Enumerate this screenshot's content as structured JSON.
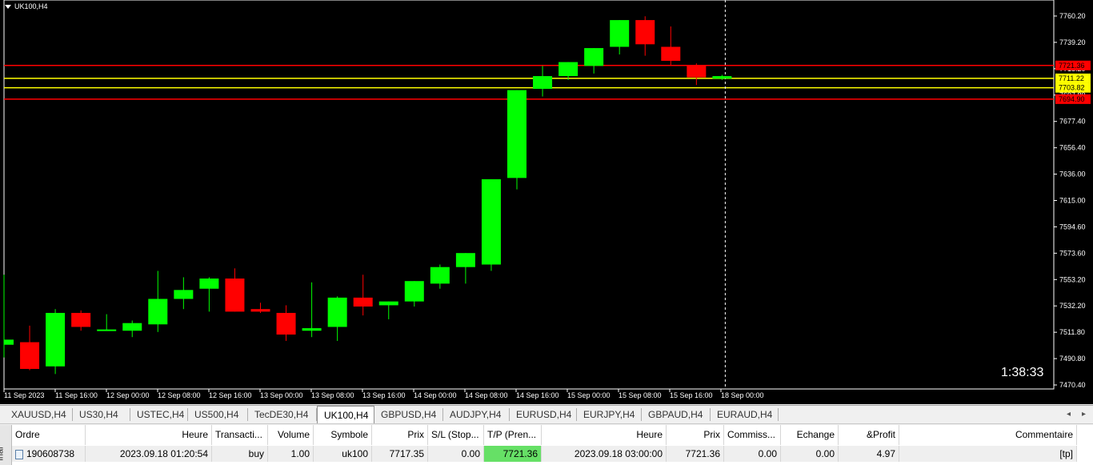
{
  "chart": {
    "symbol_label": "UK100,H4",
    "countdown": "1:38:33",
    "colors": {
      "background": "#000000",
      "bull": "#00ff00",
      "bear": "#ff0000",
      "wick_bull": "#00ff00",
      "wick_bear": "#ff0000",
      "red_line": "#ff0000",
      "yellow_line": "#ffff00",
      "axis_text": "#ffffff"
    }
  },
  "chart_data": {
    "type": "candlestick",
    "y_ticks": [
      "7760.20",
      "7739.20",
      "7718.20",
      "7697.80",
      "7677.40",
      "7656.40",
      "7636.00",
      "7615.00",
      "7594.60",
      "7573.60",
      "7553.20",
      "7532.20",
      "7511.80",
      "7490.80",
      "7470.40"
    ],
    "x_ticks": [
      "11 Sep 2023",
      "11 Sep 16:00",
      "12 Sep 00:00",
      "12 Sep 08:00",
      "12 Sep 16:00",
      "13 Sep 00:00",
      "13 Sep 08:00",
      "13 Sep 16:00",
      "14 Sep 00:00",
      "14 Sep 08:00",
      "14 Sep 16:00",
      "15 Sep 00:00",
      "15 Sep 08:00",
      "15 Sep 16:00",
      "18 Sep 00:00"
    ],
    "ylim": [
      7470.4,
      7760.2
    ],
    "candles": [
      {
        "o": 7502,
        "h": 7557,
        "l": 7492,
        "c": 7506
      },
      {
        "o": 7504,
        "h": 7517,
        "l": 7482,
        "c": 7483
      },
      {
        "o": 7485,
        "h": 7530,
        "l": 7479,
        "c": 7527
      },
      {
        "o": 7527,
        "h": 7529,
        "l": 7513,
        "c": 7516
      },
      {
        "o": 7513,
        "h": 7526,
        "l": 7513,
        "c": 7514
      },
      {
        "o": 7513,
        "h": 7521,
        "l": 7508,
        "c": 7519
      },
      {
        "o": 7518,
        "h": 7560,
        "l": 7512,
        "c": 7538
      },
      {
        "o": 7538,
        "h": 7555,
        "l": 7530,
        "c": 7545
      },
      {
        "o": 7546,
        "h": 7555,
        "l": 7528,
        "c": 7554
      },
      {
        "o": 7554,
        "h": 7562,
        "l": 7528,
        "c": 7528
      },
      {
        "o": 7530,
        "h": 7535,
        "l": 7527,
        "c": 7528
      },
      {
        "o": 7527,
        "h": 7533,
        "l": 7505,
        "c": 7510
      },
      {
        "o": 7513,
        "h": 7551,
        "l": 7508,
        "c": 7515
      },
      {
        "o": 7516,
        "h": 7540,
        "l": 7505,
        "c": 7539
      },
      {
        "o": 7539,
        "h": 7557,
        "l": 7525,
        "c": 7532
      },
      {
        "o": 7533,
        "h": 7536,
        "l": 7522,
        "c": 7536
      },
      {
        "o": 7536,
        "h": 7552,
        "l": 7532,
        "c": 7552
      },
      {
        "o": 7550,
        "h": 7565,
        "l": 7546,
        "c": 7563
      },
      {
        "o": 7563,
        "h": 7571,
        "l": 7550,
        "c": 7574
      },
      {
        "o": 7565,
        "h": 7630,
        "l": 7560,
        "c": 7632
      },
      {
        "o": 7633,
        "h": 7701,
        "l": 7624,
        "c": 7702
      },
      {
        "o": 7703,
        "h": 7721,
        "l": 7697,
        "c": 7713
      },
      {
        "o": 7713,
        "h": 7722,
        "l": 7710,
        "c": 7724
      },
      {
        "o": 7721,
        "h": 7730,
        "l": 7715,
        "c": 7735
      },
      {
        "o": 7736,
        "h": 7757,
        "l": 7730,
        "c": 7757
      },
      {
        "o": 7757,
        "h": 7760,
        "l": 7729,
        "c": 7738
      },
      {
        "o": 7736,
        "h": 7752,
        "l": 7721,
        "c": 7725
      },
      {
        "o": 7721,
        "h": 7723,
        "l": 7706,
        "c": 7712
      },
      {
        "o": 7711,
        "h": 7714,
        "l": 7710,
        "c": 7713
      }
    ],
    "levels": [
      {
        "label": "7721.36",
        "value": 7721.36,
        "color": "#ff0000",
        "tag_bg": "#ff0000",
        "tag_fg": "#000000"
      },
      {
        "label": "7711.22",
        "value": 7711.22,
        "color": "#ffff00",
        "tag_bg": "#ffff00",
        "tag_fg": "#000000"
      },
      {
        "label": "7703.82",
        "value": 7703.82,
        "color": "#ffff00",
        "tag_bg": "#ffff00",
        "tag_fg": "#000000"
      },
      {
        "label": "7694.90",
        "value": 7694.9,
        "color": "#ff0000",
        "tag_bg": "#ff0000",
        "tag_fg": "#000000"
      }
    ]
  },
  "tabs": [
    {
      "label": "XAUUSD,H4"
    },
    {
      "label": "US30,H4"
    },
    {
      "label": "USTEC,H4"
    },
    {
      "label": "US500,H4"
    },
    {
      "label": "TecDE30,H4"
    },
    {
      "label": "UK100,H4",
      "active": true
    },
    {
      "label": "GBPUSD,H4"
    },
    {
      "label": "AUDJPY,H4"
    },
    {
      "label": "EURUSD,H4"
    },
    {
      "label": "EURJPY,H4"
    },
    {
      "label": "GBPAUD,H4"
    },
    {
      "label": "EURAUD,H4"
    }
  ],
  "terminal": {
    "side_label": "inal",
    "columns": [
      "Ordre",
      "Heure",
      "Transacti...",
      "Volume",
      "Symbole",
      "Prix",
      "S/L (Stop...",
      "T/P (Pren...",
      "Heure",
      "Prix",
      "Commiss...",
      "Echange",
      "&Profit",
      "Commentaire"
    ],
    "row": [
      "190608738",
      "2023.09.18 01:20:54",
      "buy",
      "1.00",
      "uk100",
      "7717.35",
      "0.00",
      "7721.36",
      "2023.09.18 03:00:00",
      "7721.36",
      "0.00",
      "0.00",
      "4.97",
      "[tp]"
    ]
  }
}
